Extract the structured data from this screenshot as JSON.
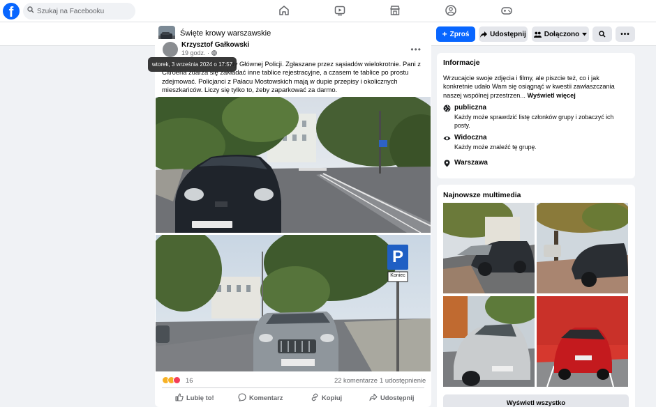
{
  "topnav": {
    "logo": "f",
    "search_placeholder": "Szukaj na Facebooku",
    "icons": [
      "home-icon",
      "video-icon",
      "marketplace-icon",
      "groups-icon",
      "gaming-icon"
    ]
  },
  "group_header": {
    "name": "Święte krowy warszawskie",
    "create_label": "Zproś",
    "share_label": "Udostępnij",
    "joined_label": "Dołączono"
  },
  "post": {
    "author": "Krzysztof Gałkowski",
    "time": "19 godz.",
    "tooltip": "wtorek, 3 września 2024 o 17:57",
    "text": "… pracowników Komendy Głównej Policji. Zgłaszane przez sąsiadów wielokrotnie. Pani z Citroena zdarza się zakładać inne tablice rejestracyjne, a czasem te tablice po prostu zdejmować. Policjanci z Pałacu Mostowskich mają w dupie przepisy i okolicznych mieszkańców. Liczy się tylko to, żeby zaparkować za darmo.",
    "sign_p": "P",
    "sign_koniec": "Koniec",
    "reaction_count": "16",
    "comments": "22 komentarze",
    "shares": "1 udostępnienie",
    "actions": {
      "like": "Lubię to!",
      "comment": "Komentarz",
      "copy": "Kopiuj",
      "share": "Udostępnij"
    }
  },
  "info": {
    "title": "Informacje",
    "description": "Wrzucajcie swoje zdjęcia i filmy, ale piszcie też, co i jak konkretnie udało Wam się osiągnąć w kwestii zawłaszczania naszej wspólnej przestrzen...",
    "see_more": "Wyświetl więcej",
    "public_title": "publiczna",
    "public_sub": "Każdy może sprawdzić listę członków grupy i zobaczyć ich posty.",
    "visible_title": "Widoczna",
    "visible_sub": "Każdy może znaleźć tę grupę.",
    "location": "Warszawa"
  },
  "media": {
    "title": "Najnowsze multimedia",
    "show_all": "Wyświetl wszystko"
  },
  "colors": {
    "brand": "#0866ff",
    "background": "#f0f2f5",
    "secondary_text": "#65676b"
  }
}
